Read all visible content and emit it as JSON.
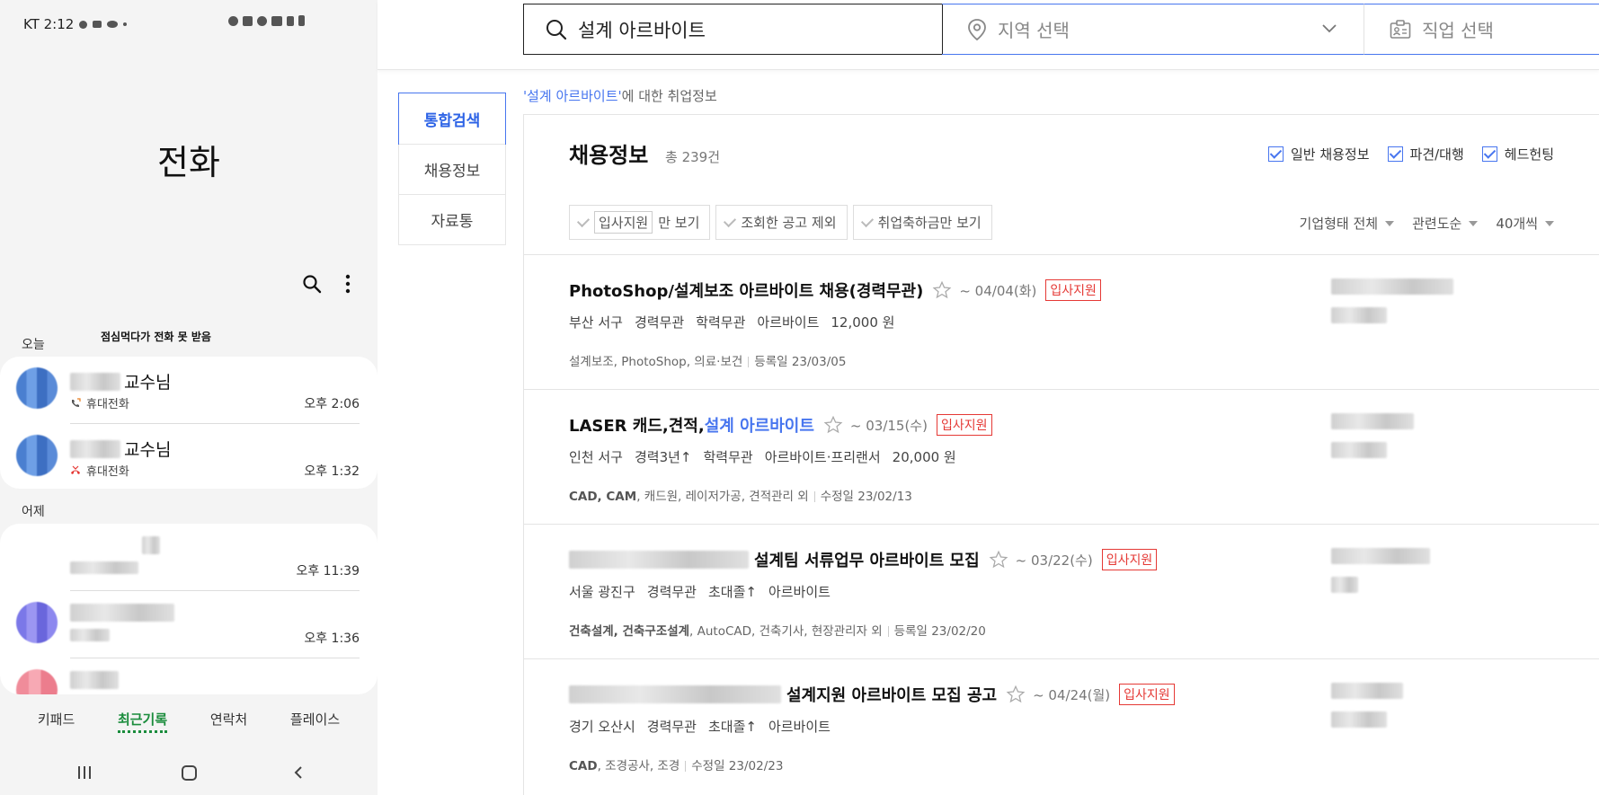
{
  "phone": {
    "status": {
      "carrier_time": "KT 2:12"
    },
    "title": "전화",
    "sections": {
      "today": "오늘",
      "yesterday": "어제"
    },
    "missed_note": "점심먹다가 전화 못 받음",
    "today_calls": [
      {
        "name_suffix": "교수님",
        "type": "휴대전화",
        "time": "오후 2:06",
        "kind": "outgoing"
      },
      {
        "name_suffix": "교수님",
        "type": "휴대전화",
        "time": "오후 1:32",
        "kind": "missed"
      }
    ],
    "yesterday_calls": [
      {
        "time": "오후 11:39"
      },
      {
        "time": "오후 1:36"
      }
    ],
    "tabs": [
      "키패드",
      "최근기록",
      "연락처",
      "플레이스"
    ],
    "active_tab": "최근기록"
  },
  "web": {
    "search": {
      "query": "설계 아르바이트"
    },
    "region": {
      "placeholder": "지역 선택"
    },
    "job": {
      "placeholder": "직업 선택"
    },
    "left_nav": [
      "통합검색",
      "채용정보",
      "자료통"
    ],
    "caption": {
      "keyword": "'설계 아르바이트'",
      "suffix": "에 대한 취업정보"
    },
    "results": {
      "title": "채용정보",
      "count": "총 239건",
      "checks": [
        "일반 채용정보",
        "파견/대행",
        "헤드헌팅"
      ],
      "filters": {
        "f1_boxed": "입사지원",
        "f1_rest": "만 보기",
        "f2": "조회한 공고 제외",
        "f3": "취업축하금만 보기"
      },
      "sorts": [
        "기업형태 전체",
        "관련도순",
        "40개씩"
      ]
    },
    "listings": [
      {
        "title": "PhotoShop/설계보조 아르바이트 채용(경력무관)",
        "deadline": "~ 04/04(화)",
        "badge": "입사지원",
        "meta": [
          "부산 서구",
          "경력무관",
          "학력무관",
          "아르바이트",
          "12,000 원"
        ],
        "tags": "설계보조, PhotoShop, 의료·보건",
        "date": "등록일 23/03/05"
      },
      {
        "title_prefix": "LASER 캐드,견적,",
        "title_hl": "설계 아르바이트",
        "deadline": "~ 03/15(수)",
        "badge": "입사지원",
        "meta": [
          "인천 서구",
          "경력3년↑",
          "학력무관",
          "아르바이트·프리랜서",
          "20,000 원"
        ],
        "tags_bold": "CAD, CAM",
        "tags": ", 캐드원, 레이저가공, 견적관리 외",
        "date": "수정일 23/02/13"
      },
      {
        "title": "설계팀 서류업무 아르바이트 모집",
        "deadline": "~ 03/22(수)",
        "badge": "입사지원",
        "meta": [
          "서울 광진구",
          "경력무관",
          "초대졸↑",
          "아르바이트"
        ],
        "tags_bold": "건축설계, 건축구조설계",
        "tags": ", AutoCAD, 건축기사, 현장관리자 외",
        "date": "등록일 23/02/20"
      },
      {
        "title": "설계지원 아르바이트 모집 공고",
        "deadline": "~ 04/24(월)",
        "badge": "입사지원",
        "meta": [
          "경기 오산시",
          "경력무관",
          "초대졸↑",
          "아르바이트"
        ],
        "tags_bold": "CAD",
        "tags": ", 조경공사, 조경",
        "date": "수정일 23/02/23"
      }
    ]
  }
}
